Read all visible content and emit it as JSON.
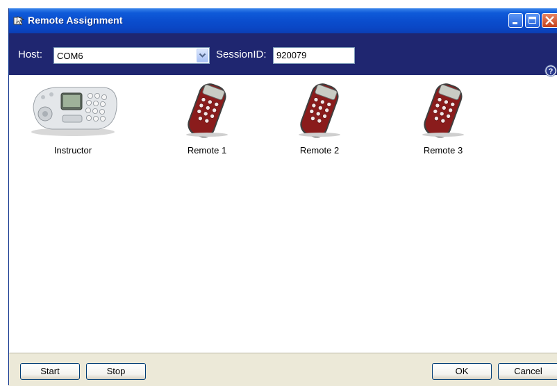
{
  "window": {
    "title": "Remote Assignment"
  },
  "hostbar": {
    "host_label": "Host:",
    "host_value": "COM6",
    "session_label": "SessionID:",
    "session_value": "920079"
  },
  "devices": [
    {
      "label": "Instructor",
      "type": "base-station"
    },
    {
      "label": "Remote 1",
      "type": "remote"
    },
    {
      "label": "Remote 2",
      "type": "remote"
    },
    {
      "label": "Remote 3",
      "type": "remote"
    }
  ],
  "footer": {
    "start_label": "Start",
    "stop_label": "Stop",
    "ok_label": "OK",
    "cancel_label": "Cancel"
  },
  "colors": {
    "titlebar": "#0a4ccc",
    "hostbar": "#1f2670",
    "footer": "#ece9d8",
    "remote_body": "#8a1c1c"
  }
}
